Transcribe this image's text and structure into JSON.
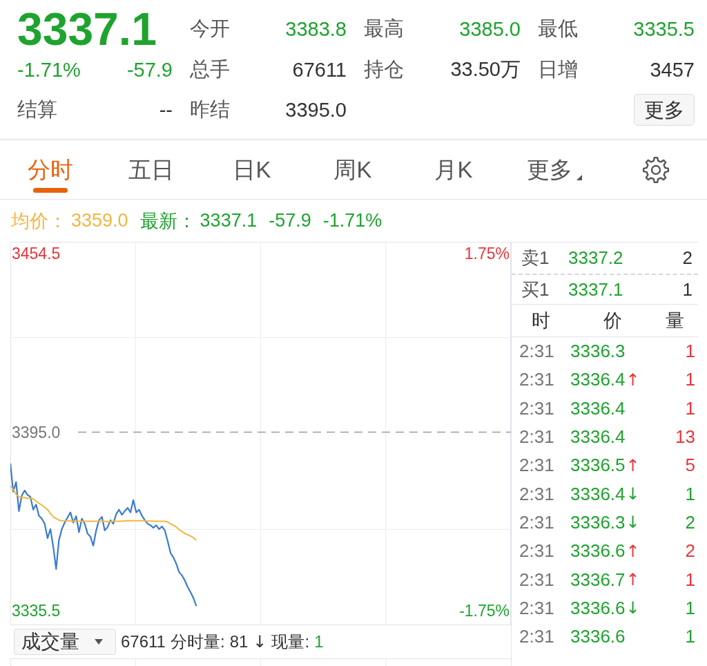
{
  "quote": {
    "price": "3337.1",
    "change_percent": "-1.71%",
    "change": "-57.9",
    "settlement": {
      "label": "结算",
      "value": "--"
    }
  },
  "stats": [
    {
      "label": "今开",
      "value": "3383.8",
      "color": "#1fa32f"
    },
    {
      "label": "最高",
      "value": "3385.0",
      "color": "#1fa32f"
    },
    {
      "label": "最低",
      "value": "3335.5",
      "color": "#1fa32f"
    },
    {
      "label": "总手",
      "value": "67611",
      "color": "#333333"
    },
    {
      "label": "持仓",
      "value": "33.50万",
      "color": "#333333"
    },
    {
      "label": "日增",
      "value": "3457",
      "color": "#333333"
    },
    {
      "label": "昨结",
      "value": "3395.0",
      "color": "#333333"
    }
  ],
  "more_button": {
    "label": "更多"
  },
  "tabs": [
    {
      "label": "分时",
      "selected": true,
      "kind": "tab"
    },
    {
      "label": "五日",
      "selected": false,
      "kind": "tab"
    },
    {
      "label": "日K",
      "selected": false,
      "kind": "tab"
    },
    {
      "label": "周K",
      "selected": false,
      "kind": "tab"
    },
    {
      "label": "月K",
      "selected": false,
      "kind": "tab"
    },
    {
      "label": "更多",
      "selected": false,
      "kind": "dropdown"
    }
  ],
  "legend": {
    "average": {
      "label": "均价：",
      "value": "3359.0"
    },
    "latest": {
      "label": "最新：",
      "price": "3337.1",
      "change": "-57.9",
      "percent": "-1.71%"
    }
  },
  "chart": {
    "chart_data": {
      "type": "line",
      "categories": [
        null,
        null,
        null,
        null,
        null,
        null,
        null,
        null,
        null,
        null,
        null,
        null,
        null,
        null,
        null,
        null,
        null,
        null,
        null,
        null,
        null,
        null,
        null,
        null,
        null,
        null,
        null,
        null,
        null,
        null,
        null,
        null,
        null,
        null,
        null,
        null,
        null,
        null,
        null,
        null,
        null,
        null,
        null,
        null,
        null,
        null,
        null,
        null,
        null,
        null,
        null,
        null,
        null,
        null,
        null,
        null,
        null,
        null,
        null,
        null,
        null,
        null,
        null,
        null,
        null,
        null,
        null,
        null,
        null,
        null,
        null,
        null,
        null,
        null,
        null,
        null,
        null,
        null,
        null,
        null,
        null,
        null,
        null,
        null,
        null,
        null,
        null,
        null,
        null,
        null,
        null,
        null,
        null,
        null,
        null,
        null,
        null,
        null,
        null,
        null,
        null,
        null,
        null,
        null,
        null,
        null,
        null,
        null,
        null,
        null,
        null,
        null,
        null,
        null,
        null,
        null,
        null,
        null,
        null,
        null,
        null,
        null,
        null,
        null,
        null,
        null,
        null,
        null,
        null,
        null,
        null,
        null,
        null,
        null,
        null,
        null,
        null,
        null,
        null,
        null,
        null,
        null,
        null,
        null,
        null,
        null,
        null,
        null,
        null,
        null,
        null,
        null,
        null,
        null,
        null,
        null,
        null,
        null,
        null,
        null,
        null,
        null,
        null,
        null,
        null,
        null,
        null,
        null,
        null,
        null,
        null,
        null,
        null,
        null,
        null
      ],
      "series": [
        {
          "color": "#3a7bd0",
          "values": [
            3384.6,
            3375.2,
            3378.4,
            3368.7,
            3373.9,
            3375.6,
            3374.1,
            3373.5,
            3369.2,
            3370.9,
            3367.2,
            3366.2,
            3364.5,
            3359.7,
            3362.7,
            3356.9,
            3349.4,
            3359.1,
            3362.7,
            3364.9,
            3366.6,
            3368.3,
            3364.9,
            3367.0,
            3361.7,
            3366.2,
            3364.5,
            3361.2,
            3360.2,
            3357.2,
            3362.3,
            3365.7,
            3366.8,
            3362.3,
            3363.4,
            3365.7,
            3364.5,
            3367.7,
            3369.2,
            3367.5,
            3368.7,
            3369.8,
            3368.3,
            3372.4,
            3368.3,
            3369.2,
            3367.2,
            3365.7,
            3364.5,
            3364.0,
            3363.2,
            3364.0,
            3362.7,
            3363.6,
            3362.3,
            3358.7,
            3354.8,
            3353.3,
            3351.2,
            3348.4,
            3347.3,
            3345.6,
            3343.4,
            3341.7,
            3339.8,
            3337.1,
            null,
            null,
            null,
            null,
            null,
            null,
            null,
            null,
            null,
            null,
            null,
            null,
            null,
            null,
            null,
            null,
            null,
            null,
            null,
            null,
            null,
            null,
            null,
            null,
            null,
            null,
            null,
            null,
            null,
            null,
            null,
            null,
            null,
            null,
            null,
            null,
            null,
            null,
            null,
            null,
            null,
            null,
            null,
            null,
            null,
            null,
            null,
            null,
            null,
            null,
            null,
            null,
            null,
            null,
            null,
            null,
            null,
            null,
            null,
            null,
            null,
            null,
            null,
            null,
            null,
            null,
            null,
            null,
            null,
            null,
            null,
            null,
            null,
            null,
            null,
            null,
            null,
            null,
            null,
            null,
            null,
            null,
            null,
            null,
            null,
            null,
            null,
            null,
            null,
            null,
            null,
            null,
            null,
            null,
            null,
            null,
            null,
            null,
            null,
            null,
            null,
            null,
            null,
            null,
            null,
            null,
            null,
            null,
            null
          ]
        },
        {
          "color": "#f5b53f",
          "values": [
            3377.1,
            3376.0,
            3374.3,
            3373.5,
            3373.2,
            3373.2,
            3373.0,
            3373.0,
            3372.8,
            3372.0,
            3371.3,
            3370.7,
            3370.0,
            3369.2,
            3367.9,
            3366.8,
            3366.2,
            3365.7,
            3365.5,
            3365.5,
            3365.5,
            3365.4,
            3365.4,
            3365.4,
            3365.3,
            3365.3,
            3365.3,
            3365.3,
            3365.3,
            3365.3,
            3365.3,
            3365.3,
            3365.3,
            3365.3,
            3365.2,
            3365.2,
            3365.3,
            3365.3,
            3365.3,
            3365.4,
            3365.4,
            3365.5,
            3365.5,
            3365.5,
            3365.5,
            3365.5,
            3365.5,
            3365.5,
            3365.4,
            3365.4,
            3365.3,
            3365.3,
            3365.3,
            3365.3,
            3365.3,
            3365.1,
            3364.5,
            3364.0,
            3363.4,
            3362.5,
            3361.9,
            3361.2,
            3360.8,
            3360.4,
            3359.9,
            3359.0,
            null,
            null,
            null,
            null,
            null,
            null,
            null,
            null,
            null,
            null,
            null,
            null,
            null,
            null,
            null,
            null,
            null,
            null,
            null,
            null,
            null,
            null,
            null,
            null,
            null,
            null,
            null,
            null,
            null,
            null,
            null,
            null,
            null,
            null,
            null,
            null,
            null,
            null,
            null,
            null,
            null,
            null,
            null,
            null,
            null,
            null,
            null,
            null,
            null,
            null,
            null,
            null,
            null,
            null,
            null,
            null,
            null,
            null,
            null,
            null,
            null,
            null,
            null,
            null,
            null,
            null,
            null,
            null,
            null,
            null,
            null,
            null,
            null,
            null,
            null,
            null,
            null,
            null,
            null,
            null,
            null,
            null,
            null,
            null,
            null,
            null,
            null,
            null,
            null,
            null,
            null,
            null,
            null,
            null,
            null,
            null,
            null,
            null,
            null,
            null,
            null,
            null,
            null,
            null,
            null,
            null,
            null,
            null,
            null
          ]
        }
      ],
      "ylim": [
        3330.7,
        3458.4
      ],
      "yticks": [
        {
          "value": 3454.5,
          "label": "3454.5"
        },
        {
          "value": 3395.0,
          "label": "3395.0"
        },
        {
          "value": 3335.5,
          "label": "3335.5"
        }
      ],
      "ref_lines": [
        {
          "axis": "y",
          "value": 3395.0
        }
      ]
    },
    "percent_labels": [
      {
        "text": "1.75%",
        "color": "#e8353b"
      },
      {
        "text": "-1.75%",
        "color": "#1fa32f"
      }
    ]
  },
  "volume_bar": {
    "selector": "成交量",
    "total": "67611",
    "minute_label": "分时量:",
    "minute_value": "81",
    "minute_arrow": "↓",
    "current_label": "现量:",
    "current_value": "1"
  },
  "order_book": [
    {
      "label": "卖1",
      "price": "3337.2",
      "qty": "2"
    },
    {
      "label": "买1",
      "price": "3337.1",
      "qty": "1"
    }
  ],
  "trades": {
    "columns": [
      "时",
      "价",
      "量"
    ],
    "rows": [
      {
        "time": "2:31",
        "price": "3336.3",
        "qty": "1",
        "color": "#e8353b"
      },
      {
        "time": "2:31",
        "price": "3336.4",
        "arrow": "↑",
        "qty": "1",
        "color": "#e8353b"
      },
      {
        "time": "2:31",
        "price": "3336.4",
        "qty": "1",
        "color": "#e8353b"
      },
      {
        "time": "2:31",
        "price": "3336.4",
        "qty": "13",
        "color": "#e8353b"
      },
      {
        "time": "2:31",
        "price": "3336.5",
        "arrow": "↑",
        "qty": "5",
        "color": "#e8353b"
      },
      {
        "time": "2:31",
        "price": "3336.4",
        "arrow": "↓",
        "qty": "1",
        "color": "#1fa32f"
      },
      {
        "time": "2:31",
        "price": "3336.3",
        "arrow": "↓",
        "qty": "2",
        "color": "#1fa32f"
      },
      {
        "time": "2:31",
        "price": "3336.6",
        "arrow": "↑",
        "qty": "2",
        "color": "#e8353b"
      },
      {
        "time": "2:31",
        "price": "3336.7",
        "arrow": "↑",
        "qty": "1",
        "color": "#e8353b"
      },
      {
        "time": "2:31",
        "price": "3336.6",
        "arrow": "↓",
        "qty": "1",
        "color": "#1fa32f"
      },
      {
        "time": "2:31",
        "price": "3336.6",
        "qty": "1",
        "color": "#1fa32f"
      }
    ]
  }
}
